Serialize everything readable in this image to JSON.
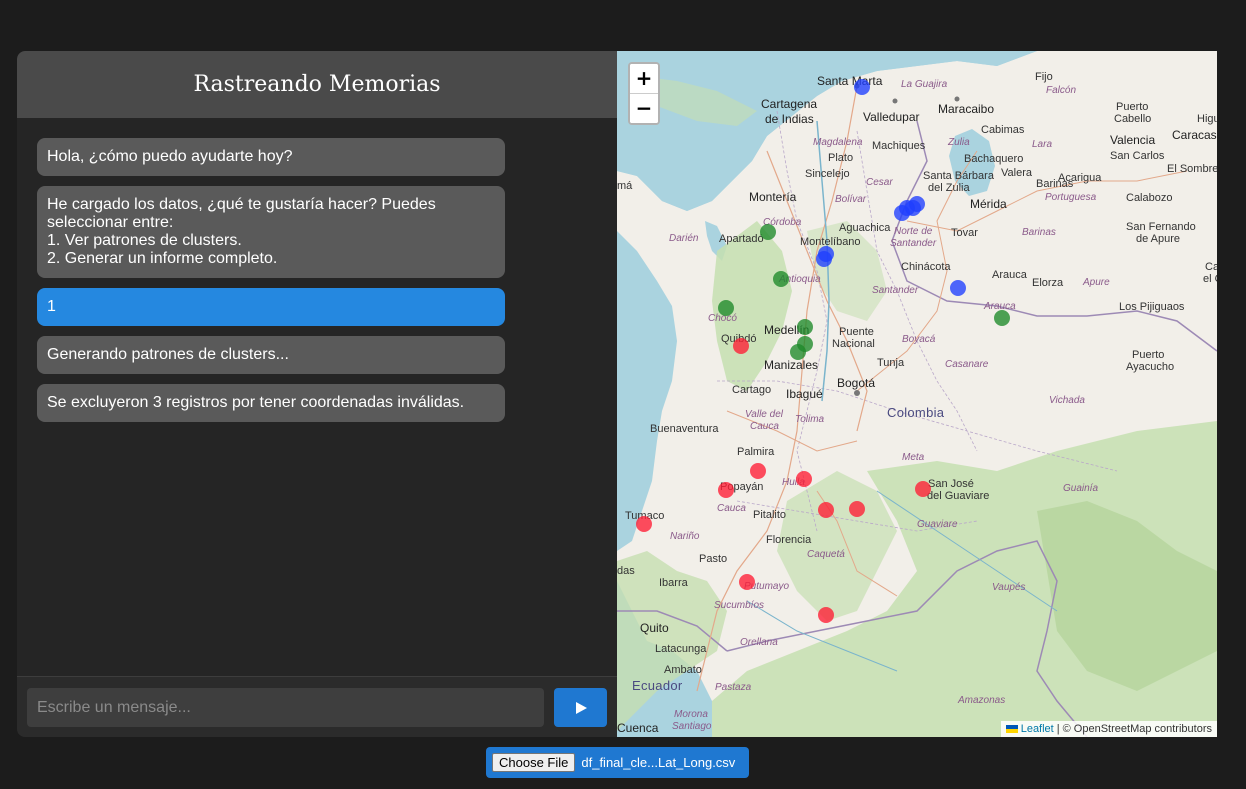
{
  "chat": {
    "title": "Rastreando Memorias",
    "messages": [
      {
        "role": "bot",
        "text": "Hola, ¿cómo puedo ayudarte hoy?"
      },
      {
        "role": "bot",
        "text": "He cargado los datos, ¿qué te gustaría hacer? Puedes seleccionar entre:\n1. Ver patrones de clusters.\n2. Generar un informe completo."
      },
      {
        "role": "user",
        "text": "1"
      },
      {
        "role": "bot",
        "text": "Generando patrones de clusters..."
      },
      {
        "role": "bot",
        "text": "Se excluyeron 3 registros por tener coordenadas inválidas."
      }
    ],
    "input_placeholder": "Escribe un mensaje...",
    "send_icon": "play-triangle-icon"
  },
  "map": {
    "zoom_in": "+",
    "zoom_out": "−",
    "attribution_link": "Leaflet",
    "attribution_text": "| © OpenStreetMap contributors",
    "cluster_colors": {
      "blue": "#1f3fff",
      "green": "#1e8a2a",
      "red": "#ff1e35"
    },
    "labels": {
      "santa_marta": "Santa Marta",
      "la_guajira": "La Guajira",
      "fijo": "Fijo",
      "cartagena": "Cartagena",
      "de_indias": "de Indias",
      "valledupar": "Valledupar",
      "maracaibo": "Maracaibo",
      "falcon": "Falcón",
      "puerto_cabello": "Puerto",
      "puerto_cabello_2": "Cabello",
      "valencia": "Valencia",
      "caracas": "Caracas",
      "higu": "Higu",
      "cabimas": "Cabimas",
      "magdalena": "Magdalena",
      "plato": "Plato",
      "machiques": "Machiques",
      "zulia": "Zulia",
      "lara": "Lara",
      "bachaquero": "Bachaquero",
      "san_carlos": "San Carlos",
      "el_sombrero": "El Sombrero",
      "sincelejo": "Sincelejo",
      "cesar": "Cesar",
      "santa_barbara": "Santa Bárbara",
      "del_zulia": "del Zulia",
      "valera": "Valera",
      "acarigua": "Acarigua",
      "portuguesa": "Portuguesa",
      "barinas_city": "Barinas",
      "calabozo": "Calabozo",
      "ma": "má",
      "monteria": "Montería",
      "bolivar": "Bolívar",
      "merida": "Mérida",
      "cordoba": "Córdoba",
      "norte_de": "Norte de",
      "santander_n": "Santander",
      "tovar": "Tovar",
      "barinas_region": "Barinas",
      "san_fernando": "San Fernando",
      "de_apure": "de Apure",
      "darien": "Darién",
      "apartado": "Apartadó",
      "aguachica": "Aguachica",
      "montelibano": "Montelíbano",
      "chinacota": "Chinácota",
      "antioquia": "Antioquia",
      "arauca_city": "Arauca",
      "elorza": "Elorza",
      "apure": "Apure",
      "cai": "Cai",
      "el_o": "el Or",
      "santander": "Santander",
      "arauca_region": "Arauca",
      "los_pijiguaos": "Los Pijiguaos",
      "choco": "Chocó",
      "medellin": "Medellín",
      "puente": "Puente",
      "nacional": "Nacional",
      "boyaca": "Boyacá",
      "quibdo": "Quibdó",
      "casanare": "Casanare",
      "puerto_ayacucho": "Puerto",
      "puerto_ayacucho_2": "Ayacucho",
      "manizales": "Manizales",
      "tunja": "Tunja",
      "bogota": "Bogotá",
      "cartago": "Cartago",
      "ibague": "Ibagué",
      "colombia": "Colombia",
      "vichada": "Vichada",
      "valle_del": "Valle del",
      "cauca_v": "Cauca",
      "tolima": "Tolima",
      "buenaventura": "Buenaventura",
      "meta": "Meta",
      "palmira": "Palmira",
      "huila": "Huila",
      "san_jose": "San José",
      "del_guaviare": "del Guaviare",
      "guainia": "Guainía",
      "popayan": "Popayán",
      "cauca": "Cauca",
      "pitalito": "Pitalito",
      "tumaco": "Tumaco",
      "guaviare": "Guaviare",
      "narino": "Nariño",
      "florencia": "Florencia",
      "caqueta": "Caquetá",
      "pasto": "Pasto",
      "das": "das",
      "ibarra": "Ibarra",
      "putumayo": "Putumayo",
      "vaupes": "Vaupés",
      "sucumbios": "Sucumbíos",
      "quito": "Quito",
      "orellana": "Orellana",
      "latacunga": "Latacunga",
      "ambato": "Ambato",
      "ecuador": "Ecuador",
      "pastaza": "Pastaza",
      "amazonas": "Amazonas",
      "morona": "Morona",
      "santiago": "Santiago",
      "cuenca": "Cuenca"
    },
    "markers": [
      {
        "cluster": "blue"
      },
      {
        "cluster": "blue"
      },
      {
        "cluster": "blue"
      },
      {
        "cluster": "blue"
      },
      {
        "cluster": "blue"
      },
      {
        "cluster": "blue"
      },
      {
        "cluster": "blue"
      },
      {
        "cluster": "blue"
      },
      {
        "cluster": "green"
      },
      {
        "cluster": "green"
      },
      {
        "cluster": "green"
      },
      {
        "cluster": "green"
      },
      {
        "cluster": "green"
      },
      {
        "cluster": "green"
      },
      {
        "cluster": "green"
      },
      {
        "cluster": "red"
      },
      {
        "cluster": "red"
      },
      {
        "cluster": "red"
      },
      {
        "cluster": "red"
      },
      {
        "cluster": "red"
      },
      {
        "cluster": "red"
      },
      {
        "cluster": "red"
      },
      {
        "cluster": "red"
      },
      {
        "cluster": "red"
      },
      {
        "cluster": "red"
      }
    ]
  },
  "file_input": {
    "button_label": "Choose File",
    "file_name": "df_final_cle...Lat_Long.csv"
  }
}
